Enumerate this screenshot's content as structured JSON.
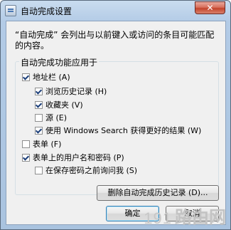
{
  "window": {
    "title": "自动完成设置",
    "close_label": "✕"
  },
  "description": "“自动完成” 会列出与以前键入或访问的条目可能匹配的内容。",
  "group_label": "自动完成功能应用于",
  "options": {
    "address_bar": {
      "label": "地址栏 (A)",
      "checked": true
    },
    "browse_history": {
      "label": "浏览历史记录 (H)",
      "checked": true
    },
    "favorites": {
      "label": "收藏夹 (V)",
      "checked": true
    },
    "feeds": {
      "label": "源 (E)",
      "checked": false
    },
    "windows_search": {
      "label": "使用 Windows Search 获得更好的结果 (W)",
      "checked": true
    },
    "forms": {
      "label": "表单 (F)",
      "checked": false
    },
    "usernames_passwords": {
      "label": "表单上的用户名和密码 (P)",
      "checked": true
    },
    "ask_before_save": {
      "label": "在保存密码之前询问我 (S)",
      "checked": false
    }
  },
  "buttons": {
    "delete_history": "删除自动完成历史记录 (D)...",
    "ok": "确定",
    "cancel": "取消"
  },
  "watermark": {
    "digits": "191",
    "text": "路由网"
  },
  "icons": {
    "app": "autocomplete-settings-icon",
    "close": "close-icon"
  },
  "colors": {
    "title_bar": "#b3cbe6",
    "close_button": "#c3432b",
    "dialog_bg": "#f0f0f0"
  }
}
